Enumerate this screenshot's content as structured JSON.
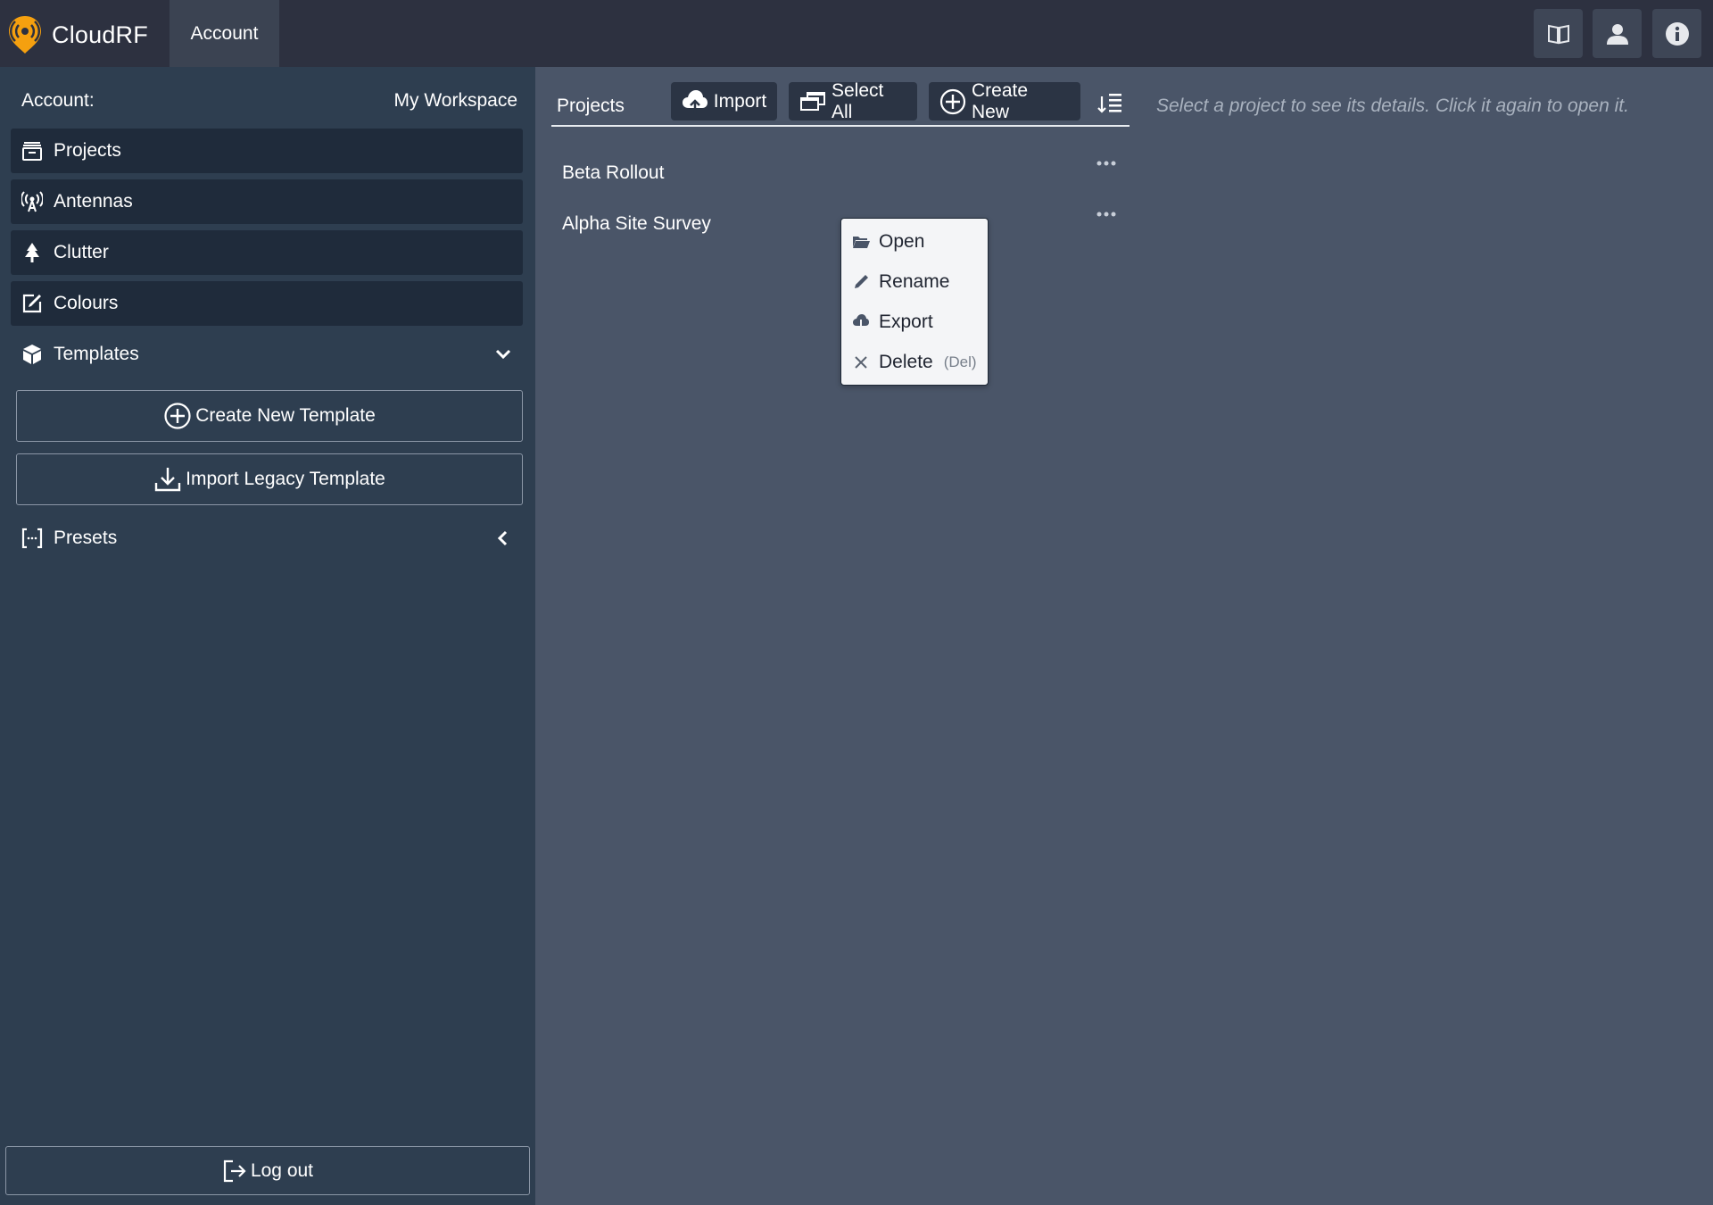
{
  "app": {
    "name": "CloudRF",
    "tab": "Account"
  },
  "colors": {
    "topbar": "#2d3140",
    "sidebar": "#2e3e50",
    "nav_item": "#1f2b3b",
    "main": "#4a5568",
    "brand_orange": "#f5a00f"
  },
  "header_icons": [
    "book-icon",
    "user-icon",
    "info-icon"
  ],
  "sidebar": {
    "account_label": "Account:",
    "workspace": "My Workspace",
    "items": [
      {
        "label": "Projects",
        "icon": "archive-icon"
      },
      {
        "label": "Antennas",
        "icon": "antenna-icon"
      },
      {
        "label": "Clutter",
        "icon": "tree-icon"
      },
      {
        "label": "Colours",
        "icon": "edit-icon"
      }
    ],
    "templates": {
      "label": "Templates",
      "icon": "cube-icon",
      "expanded": true
    },
    "create_template": "Create New Template",
    "import_template": "Import Legacy Template",
    "presets": {
      "label": "Presets",
      "icon": "brackets-icon",
      "expanded": false
    },
    "logout": "Log out"
  },
  "projects": {
    "title": "Projects",
    "toolbar": {
      "import": "Import",
      "select_all": "Select All",
      "create_new": "Create New"
    },
    "hint": "Select a project to see its details. Click it again to open it.",
    "rows": [
      {
        "name": "Beta Rollout"
      },
      {
        "name": "Alpha Site Survey"
      }
    ]
  },
  "context_menu": {
    "open": "Open",
    "rename": "Rename",
    "export": "Export",
    "delete": "Delete",
    "delete_shortcut": "(Del)"
  }
}
